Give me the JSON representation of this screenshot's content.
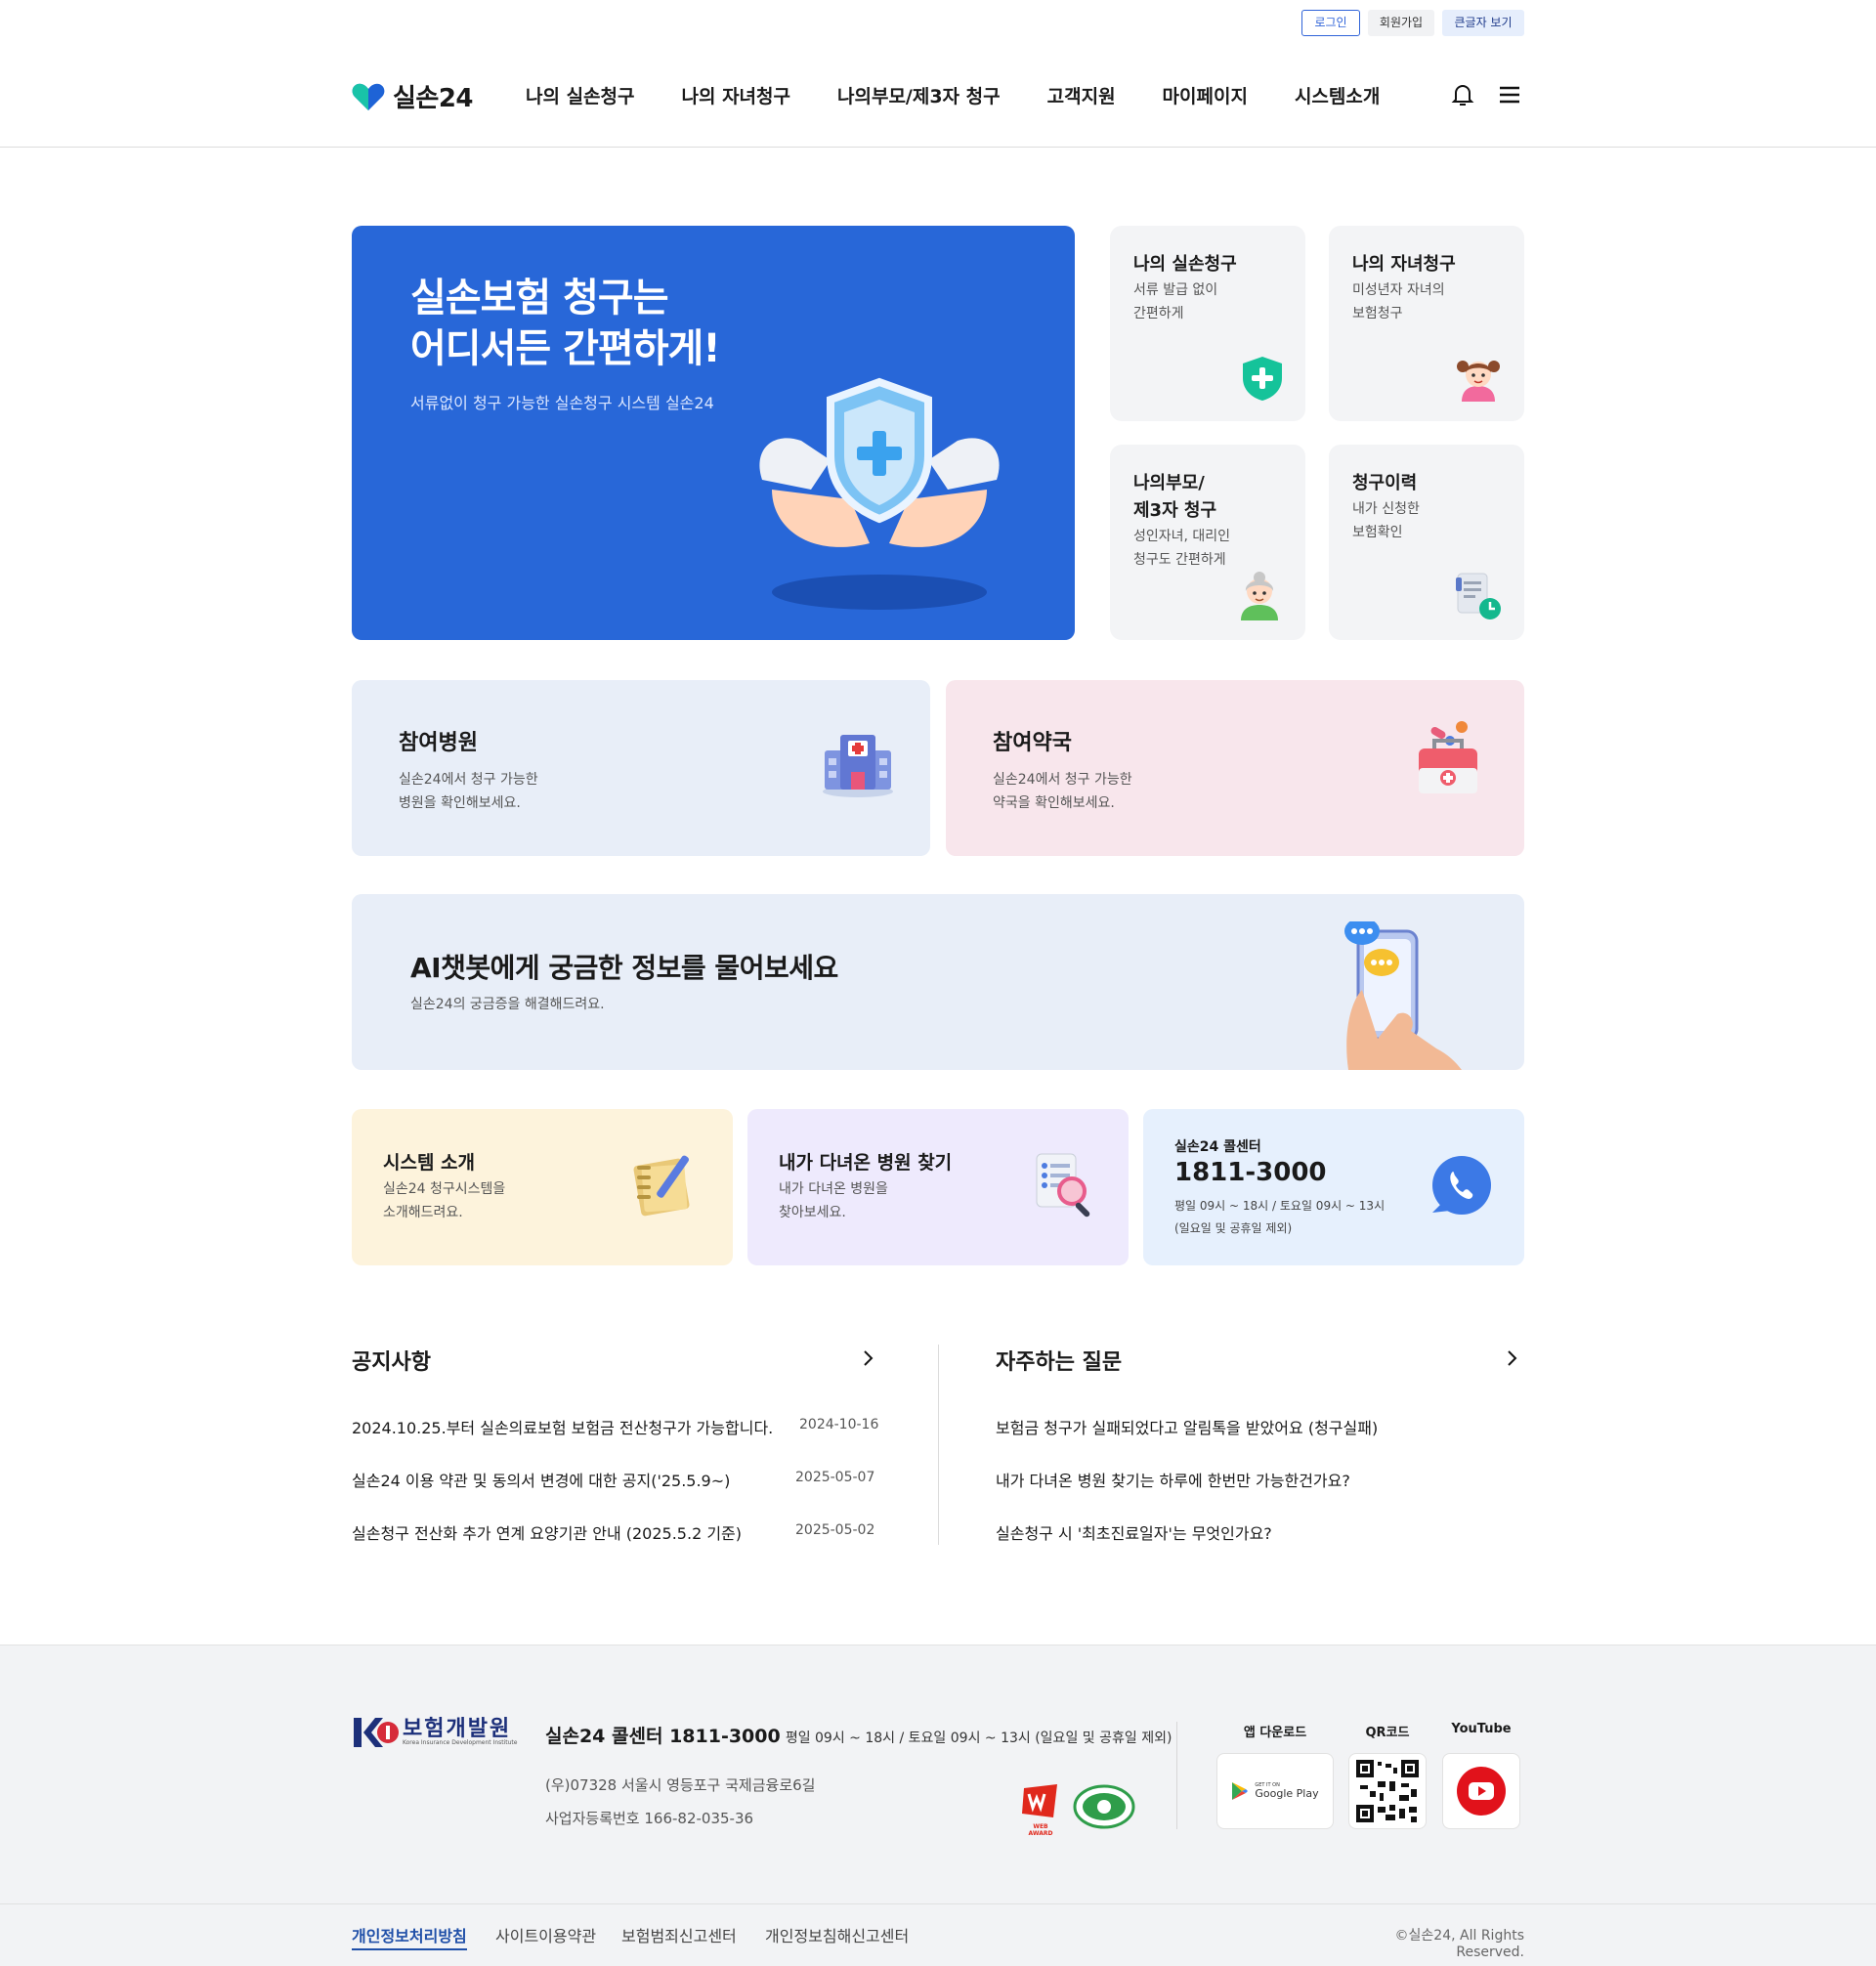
{
  "header": {
    "util": {
      "login": "로그인",
      "join": "회원가입",
      "large_text": "큰글자 보기"
    },
    "logo": "실손24",
    "nav": [
      "나의 실손청구",
      "나의 자녀청구",
      "나의부모/제3자 청구",
      "고객지원",
      "마이페이지",
      "시스템소개"
    ]
  },
  "hero": {
    "title": "실손보험 청구는\n어디서든 간편하게!",
    "subtitle": "서류없이 청구 가능한 실손청구 시스템 실손24"
  },
  "quick_menu": [
    {
      "title": "나의 실손청구",
      "desc": "서류 발급 없이\n간편하게",
      "icon": "shield-plus-icon"
    },
    {
      "title": "나의 자녀청구",
      "desc": "미성년자 자녀의\n보험청구",
      "icon": "child-icon"
    },
    {
      "title": "나의부모/\n제3자 청구",
      "desc": "성인자녀, 대리인\n청구도 간편하게",
      "icon": "grandparent-icon"
    },
    {
      "title": "청구이력",
      "desc": "내가 신청한\n보험확인",
      "icon": "document-clock-icon"
    }
  ],
  "partner": {
    "hospital": {
      "title": "참여병원",
      "desc": "실손24에서 청구 가능한\n병원을 확인해보세요."
    },
    "pharmacy": {
      "title": "참여약국",
      "desc": "실손24에서 청구 가능한\n약국을 확인해보세요."
    }
  },
  "ai": {
    "title": "AI챗봇에게 궁금한 정보를 물어보세요",
    "desc": "실손24의 궁금증을 해결해드려요."
  },
  "cards": {
    "system": {
      "title": "시스템 소개",
      "desc": "실손24 청구시스템을\n소개해드려요."
    },
    "visited": {
      "title": "내가 다녀온 병원 찾기",
      "desc": "내가 다녀온 병원을\n찾아보세요."
    },
    "callcenter": {
      "label": "실손24 콜센터",
      "phone": "1811-3000",
      "hours": "평일 09시 ~ 18시 / 토요일 09시 ~ 13시",
      "note": "(일요일 및 공휴일 제외)"
    }
  },
  "notice": {
    "title": "공지사항",
    "items": [
      {
        "text": "2024.10.25.부터 실손의료보험 보험금 전산청구가 가능합니다.",
        "date": "2024-10-16"
      },
      {
        "text": "실손24 이용 약관 및 동의서 변경에 대한 공지('25.5.9~)",
        "date": "2025-05-07"
      },
      {
        "text": "실손청구 전산화 추가 연계 요양기관 안내 (2025.5.2 기준)",
        "date": "2025-05-02"
      }
    ]
  },
  "faq": {
    "title": "자주하는 질문",
    "items": [
      "보험금 청구가 실패되었다고 알림톡을 받았어요 (청구실패)",
      "내가 다녀온 병원 찾기는 하루에 한번만 가능한건가요?",
      "실손청구 시 '최초진료일자'는 무엇인가요?"
    ]
  },
  "footer": {
    "org_name": "보험개발원",
    "org_name_en": "Korea Insurance Development Institute",
    "call_label": "실손24 콜센터 1811-3000",
    "call_hours": "평일 09시 ~ 18시 / 토요일 09시 ~ 13시 (일요일 및 공휴일 제외)",
    "address": "(우)07328 서울시 영등포구 국제금융로6길",
    "biz_no": "사업자등록번호 166-82-035-36",
    "app_label": "앱 다운로드",
    "qr_label": "QR코드",
    "youtube_label": "YouTube",
    "google_play_small": "GET IT ON",
    "google_play": "Google Play",
    "web_award": "WEB AWARD",
    "links": [
      "개인정보처리방침",
      "사이트이용약관",
      "보험범죄신고센터",
      "개인정보침해신고센터"
    ],
    "copyright": "©실손24, All Rights Reserved."
  },
  "colors": {
    "primary": "#2867d8",
    "hospital_bg": "#e8eef8",
    "pharmacy_bg": "#f8e6ec",
    "system_bg": "#fdf3dc",
    "visited_bg": "#eeeafd",
    "call_bg": "#e6f0fd"
  }
}
